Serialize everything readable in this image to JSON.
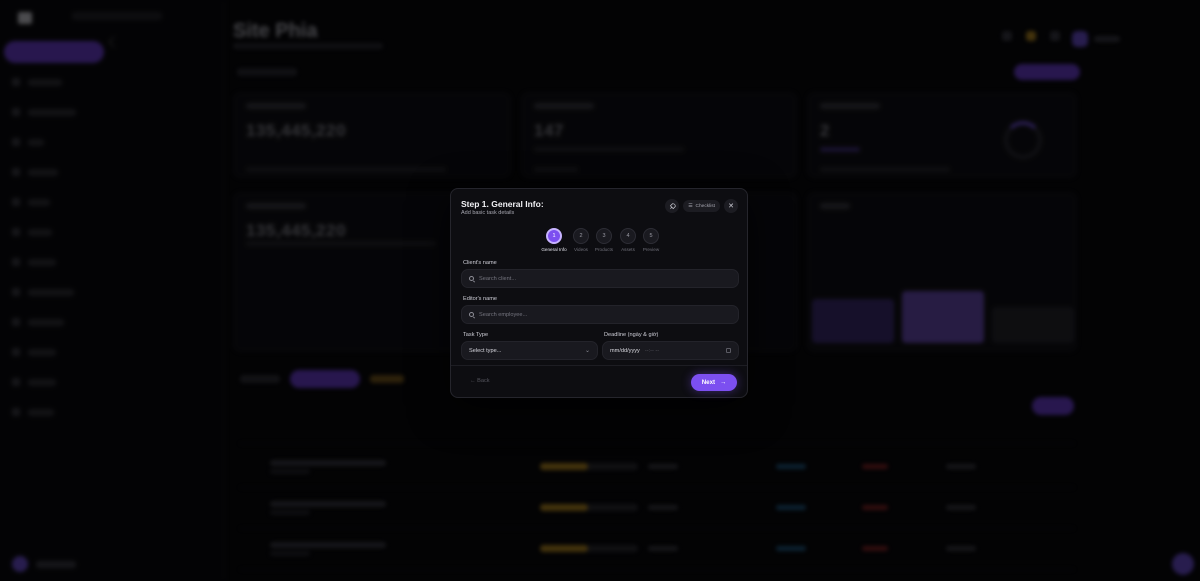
{
  "app": {
    "page_title": "Site Phia",
    "colors": {
      "accent": "#7c4ff0",
      "background": "#050507",
      "modal": "#0d0d11",
      "amber": "#b88a1e"
    },
    "cards": {
      "total_revenue": "135,445,220",
      "total_tasks": "147",
      "pending_revenue": "135,445,220"
    }
  },
  "modal": {
    "title": "Step 1. General Info:",
    "subtitle": "Add basic task details",
    "close_icon": "close-icon",
    "rocket_icon": "rocket-icon",
    "checklist_chip": "Checklist",
    "steps": [
      {
        "num": "1",
        "label": "General Info",
        "active": true
      },
      {
        "num": "2",
        "label": "Videos",
        "active": false
      },
      {
        "num": "3",
        "label": "Products",
        "active": false
      },
      {
        "num": "4",
        "label": "Assets",
        "active": false
      },
      {
        "num": "5",
        "label": "Preview",
        "active": false
      }
    ],
    "client": {
      "label": "Client's name",
      "placeholder": "Search client..."
    },
    "editor": {
      "label": "Editor's name",
      "placeholder": "Search employee..."
    },
    "task_type": {
      "label": "Task Type",
      "value": "Select type..."
    },
    "deadline": {
      "label": "Deadline (ngày & giờ)",
      "date_placeholder": "mm/dd/yyyy",
      "time_placeholder": "--:-- --"
    },
    "back_label": "Back",
    "next_label": "Next"
  }
}
